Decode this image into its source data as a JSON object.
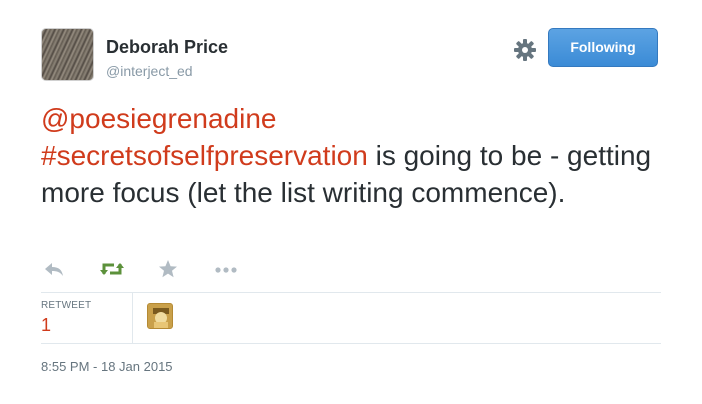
{
  "user": {
    "name": "Deborah Price",
    "handle": "@interject_ed"
  },
  "follow_button": {
    "label": "Following"
  },
  "tweet": {
    "mention": "@poesiegrenadine",
    "hashtag": "#secretsofselfpreservation",
    "text_rest": " is going to be - getting more focus (let the list writing commence)."
  },
  "actions": {
    "icons": [
      "reply-icon",
      "retweet-icon",
      "favorite-icon",
      "more-icon"
    ],
    "retweet_color": "#5c913b"
  },
  "stats": {
    "retweet_label": "RETWEET",
    "retweet_count": "1"
  },
  "timestamp": "8:55 PM - 18 Jan 2015",
  "colors": {
    "accent": "#d03b1c",
    "button": "#3b8bd6",
    "text": "#292f33",
    "muted": "#8899a6"
  }
}
